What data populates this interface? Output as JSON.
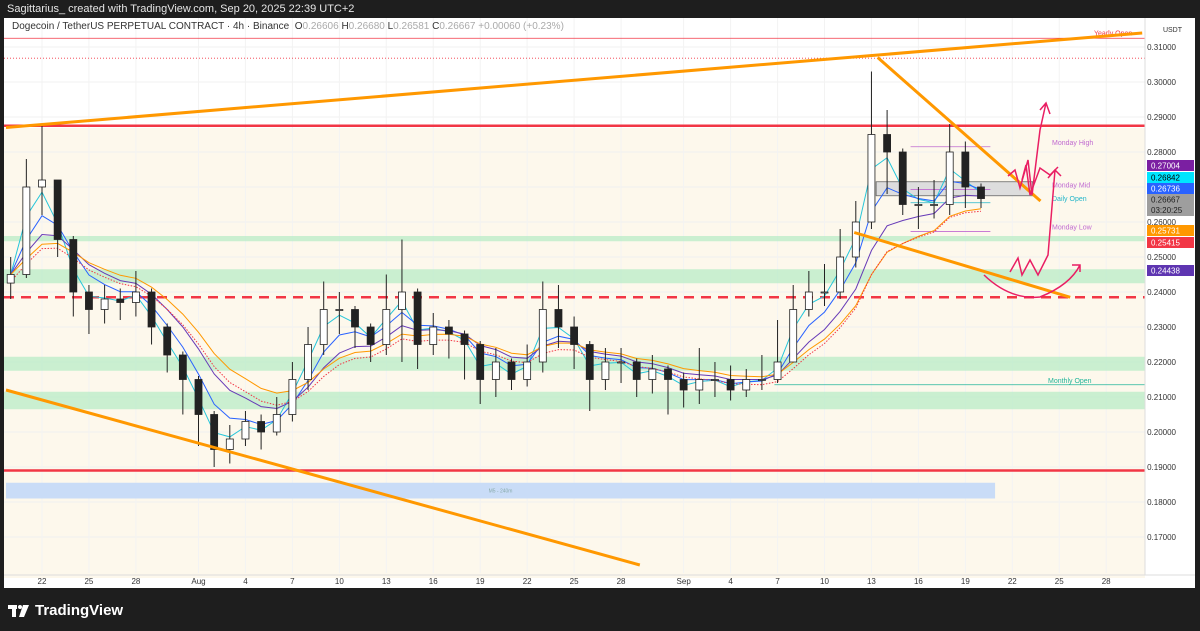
{
  "header": {
    "credit": "Sagittarius_ created with TradingView.com, Sep 20, 2025 22:39 UTC+2"
  },
  "legend": {
    "symbol": "Dogecoin / TetherUS PERPETUAL CONTRACT · 4h · Binance",
    "o_label": "O",
    "o": "0.26606",
    "h_label": "H",
    "h": "0.26680",
    "l_label": "L",
    "l": "0.26581",
    "c_label": "C",
    "c": "0.26667",
    "change": "+0.00060 (+0.23%)"
  },
  "footer": {
    "brand": "TradingView"
  },
  "chart_data": {
    "type": "candlestick",
    "title": "Dogecoin / TetherUS PERPETUAL CONTRACT · 4h · Binance",
    "currency": "USDT",
    "ylim": [
      0.163,
      0.314
    ],
    "y_ticks": [
      "0.31000",
      "0.30000",
      "0.29000",
      "0.28000",
      "0.27000",
      "0.26000",
      "0.25000",
      "0.24000",
      "0.23000",
      "0.22000",
      "0.21000",
      "0.20000",
      "0.19000",
      "0.18000",
      "0.17000"
    ],
    "x_ticks": [
      {
        "day": 0,
        "label": "22"
      },
      {
        "day": 3,
        "label": "25"
      },
      {
        "day": 6,
        "label": "28"
      },
      {
        "day": 10,
        "label": "Aug"
      },
      {
        "day": 13,
        "label": "4"
      },
      {
        "day": 16,
        "label": "7"
      },
      {
        "day": 19,
        "label": "10"
      },
      {
        "day": 22,
        "label": "13"
      },
      {
        "day": 25,
        "label": "16"
      },
      {
        "day": 28,
        "label": "19"
      },
      {
        "day": 31,
        "label": "22"
      },
      {
        "day": 34,
        "label": "25"
      },
      {
        "day": 37,
        "label": "28"
      },
      {
        "day": 41,
        "label": "Sep"
      },
      {
        "day": 44,
        "label": "4"
      },
      {
        "day": 47,
        "label": "7"
      },
      {
        "day": 50,
        "label": "10"
      },
      {
        "day": 53,
        "label": "13"
      },
      {
        "day": 56,
        "label": "16"
      },
      {
        "day": 59,
        "label": "19"
      },
      {
        "day": 62,
        "label": "22"
      },
      {
        "day": 65,
        "label": "25"
      },
      {
        "day": 68,
        "label": "28"
      }
    ],
    "x_note": "day index 0 = Jul 22",
    "start_day": -2,
    "close": [
      0.245,
      0.27,
      0.272,
      0.255,
      0.24,
      0.235,
      0.238,
      0.237,
      0.24,
      0.23,
      0.222,
      0.215,
      0.205,
      0.195,
      0.198,
      0.203,
      0.2,
      0.205,
      0.215,
      0.225,
      0.235,
      0.235,
      0.23,
      0.225,
      0.235,
      0.24,
      0.225,
      0.23,
      0.228,
      0.225,
      0.215,
      0.22,
      0.215,
      0.22,
      0.235,
      0.23,
      0.225,
      0.215,
      0.22,
      0.22,
      0.215,
      0.218,
      0.215,
      0.212,
      0.215,
      0.215,
      0.212,
      0.215,
      0.215,
      0.22,
      0.235,
      0.24,
      0.24,
      0.25,
      0.26,
      0.285,
      0.28,
      0.265,
      0.265,
      0.265,
      0.28,
      0.27,
      0.2667
    ],
    "high": [
      0.25,
      0.278,
      0.288,
      0.272,
      0.256,
      0.242,
      0.242,
      0.241,
      0.246,
      0.241,
      0.231,
      0.223,
      0.216,
      0.206,
      0.202,
      0.206,
      0.205,
      0.21,
      0.22,
      0.23,
      0.243,
      0.24,
      0.236,
      0.231,
      0.245,
      0.255,
      0.241,
      0.234,
      0.232,
      0.229,
      0.226,
      0.224,
      0.221,
      0.225,
      0.243,
      0.242,
      0.233,
      0.226,
      0.224,
      0.224,
      0.221,
      0.222,
      0.219,
      0.217,
      0.224,
      0.22,
      0.219,
      0.218,
      0.222,
      0.232,
      0.242,
      0.246,
      0.248,
      0.258,
      0.266,
      0.303,
      0.292,
      0.281,
      0.27,
      0.272,
      0.288,
      0.283,
      0.271
    ],
    "low": [
      0.238,
      0.244,
      0.262,
      0.25,
      0.233,
      0.228,
      0.231,
      0.232,
      0.233,
      0.225,
      0.217,
      0.205,
      0.196,
      0.19,
      0.191,
      0.196,
      0.195,
      0.199,
      0.203,
      0.212,
      0.222,
      0.228,
      0.224,
      0.22,
      0.222,
      0.22,
      0.218,
      0.222,
      0.221,
      0.215,
      0.208,
      0.21,
      0.212,
      0.213,
      0.217,
      0.224,
      0.218,
      0.206,
      0.212,
      0.214,
      0.21,
      0.211,
      0.205,
      0.207,
      0.208,
      0.21,
      0.209,
      0.21,
      0.212,
      0.214,
      0.226,
      0.233,
      0.236,
      0.238,
      0.247,
      0.258,
      0.268,
      0.262,
      0.258,
      0.261,
      0.262,
      0.264,
      0.264
    ],
    "levels": [
      {
        "name": "Yearly Open",
        "price": 0.3125,
        "color": "#f23645",
        "style": "solid-thin"
      },
      {
        "name": "",
        "price": 0.3068,
        "color": "#f23645",
        "style": "dotted"
      },
      {
        "name": "",
        "price": 0.2875,
        "color": "#f23645",
        "style": "solid-thick"
      },
      {
        "name": "",
        "price": 0.2385,
        "color": "#f23645",
        "style": "dashed"
      },
      {
        "name": "",
        "price": 0.189,
        "color": "#f23645",
        "style": "solid-thick"
      }
    ],
    "zones": [
      {
        "top": 0.256,
        "bottom": 0.2545,
        "color": "#b8ecc7"
      },
      {
        "top": 0.2465,
        "bottom": 0.2425,
        "color": "#b8ecc7"
      },
      {
        "top": 0.2215,
        "bottom": 0.2175,
        "color": "#b8ecc7"
      },
      {
        "top": 0.2115,
        "bottom": 0.2065,
        "color": "#b8ecc7"
      }
    ],
    "htf_zone": {
      "label": "M5 - 240m",
      "top": 0.1855,
      "bottom": 0.181,
      "from_day": -2.3,
      "to_day": 60.9
    },
    "session_levels": [
      {
        "name": "Monday High",
        "price": 0.2815,
        "color": "#c06ad0"
      },
      {
        "name": "Monday Mid",
        "price": 0.2693,
        "color": "#c06ad0"
      },
      {
        "name": "Daily Open",
        "price": 0.2655,
        "color": "#22b5c9"
      },
      {
        "name": "Monday Low",
        "price": 0.2573,
        "color": "#c06ad0"
      },
      {
        "name": "Monthly Open",
        "price": 0.2135,
        "color": "#22b59a"
      }
    ],
    "trendlines": [
      {
        "from": [
          -2.3,
          0.287
        ],
        "to": [
          70.3,
          0.314
        ]
      },
      {
        "from": [
          -2.3,
          0.212
        ],
        "to": [
          38.2,
          0.162
        ]
      },
      {
        "from": [
          53.4,
          0.307
        ],
        "to": [
          63.8,
          0.266
        ]
      },
      {
        "from": [
          51.9,
          0.257
        ],
        "to": [
          65.7,
          0.2385
        ]
      }
    ],
    "price_tags": [
      {
        "value": "0.27004",
        "color": "#7b1fa2"
      },
      {
        "value": "0.26842",
        "color": "#00e5ff"
      },
      {
        "value": "0.26736",
        "color": "#2962ff"
      },
      {
        "value": "0.26667",
        "sub": "03:20:25",
        "color": "#9e9e9e"
      },
      {
        "value": "0.25731",
        "color": "#ff9800"
      },
      {
        "value": "0.25415",
        "color": "#f23645"
      },
      {
        "value": "0.24438",
        "color": "#5e35b1"
      }
    ]
  }
}
